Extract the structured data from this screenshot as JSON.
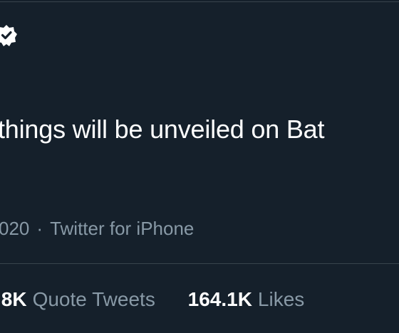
{
  "tweet": {
    "text": "things will be unveiled on Bat",
    "timestamp_fragment": "020",
    "separator": "·",
    "source": "Twitter for iPhone"
  },
  "stats": {
    "quote_tweets": {
      "count": ".8K",
      "label": "Quote Tweets"
    },
    "likes": {
      "count": "164.1K",
      "label": "Likes"
    }
  },
  "icons": {
    "verified": "verified-badge-icon"
  },
  "colors": {
    "background": "#15202b",
    "divider": "#38444d",
    "primary_text": "#ffffff",
    "secondary_text": "#8899a6"
  }
}
